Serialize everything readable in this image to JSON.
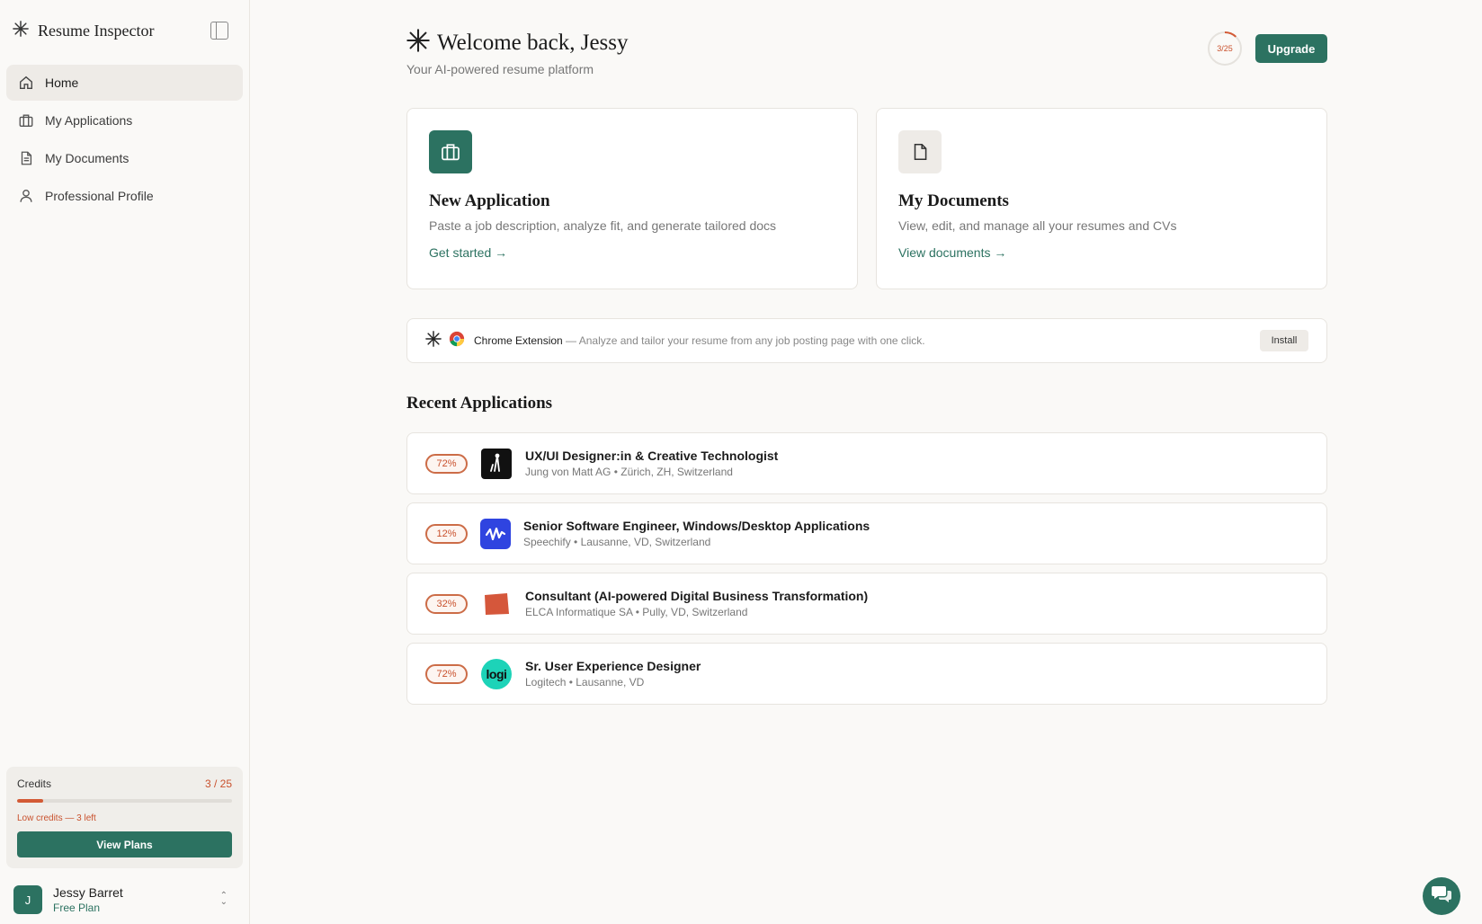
{
  "app": {
    "title": "Resume Inspector"
  },
  "sidebar": {
    "items": [
      {
        "label": "Home",
        "icon": "home-icon",
        "active": true
      },
      {
        "label": "My Applications",
        "icon": "briefcase-icon"
      },
      {
        "label": "My Documents",
        "icon": "document-icon"
      },
      {
        "label": "Professional Profile",
        "icon": "user-icon"
      }
    ],
    "credits": {
      "label": "Credits",
      "count": "3 / 25",
      "used": 3,
      "total": 25,
      "warning": "Low credits — 3 left",
      "button": "View Plans"
    },
    "user": {
      "initial": "J",
      "name": "Jessy Barret",
      "plan": "Free Plan"
    }
  },
  "header": {
    "title": "Welcome back, Jessy",
    "subtitle": "Your AI-powered resume platform",
    "usage": "3/25",
    "usage_fraction": 0.12,
    "upgrade": "Upgrade"
  },
  "cards": [
    {
      "title": "New Application",
      "desc": "Paste a job description, analyze fit, and generate tailored docs",
      "link": "Get started →",
      "icon": "briefcase-icon"
    },
    {
      "title": "My Documents",
      "desc": "View, edit, and manage all your resumes and CVs",
      "link": "View documents →",
      "icon": "document-icon"
    }
  ],
  "extension": {
    "name": "Chrome Extension",
    "desc": " — Analyze and tailor your resume from any job posting page with one click.",
    "button": "Install"
  },
  "recent": {
    "title": "Recent Applications",
    "items": [
      {
        "score": "72%",
        "title": "UX/UI Designer:in & Creative Technologist",
        "meta": "Jung von Matt AG • Zürich, ZH, Switzerland",
        "logo": "jung-von-matt-logo"
      },
      {
        "score": "12%",
        "title": "Senior Software Engineer, Windows/Desktop Applications",
        "meta": "Speechify • Lausanne, VD, Switzerland",
        "logo": "speechify-logo"
      },
      {
        "score": "32%",
        "title": "Consultant (AI-powered Digital Business Transformation)",
        "meta": "ELCA Informatique SA • Pully, VD, Switzerland",
        "logo": "elca-logo"
      },
      {
        "score": "72%",
        "title": "Sr. User Experience Designer",
        "meta": "Logitech • Lausanne, VD",
        "logo": "logitech-logo",
        "logo_text": "logi"
      }
    ]
  },
  "colors": {
    "accent": "#2c7261",
    "warning": "#c9512d",
    "background": "#faf9f7"
  }
}
